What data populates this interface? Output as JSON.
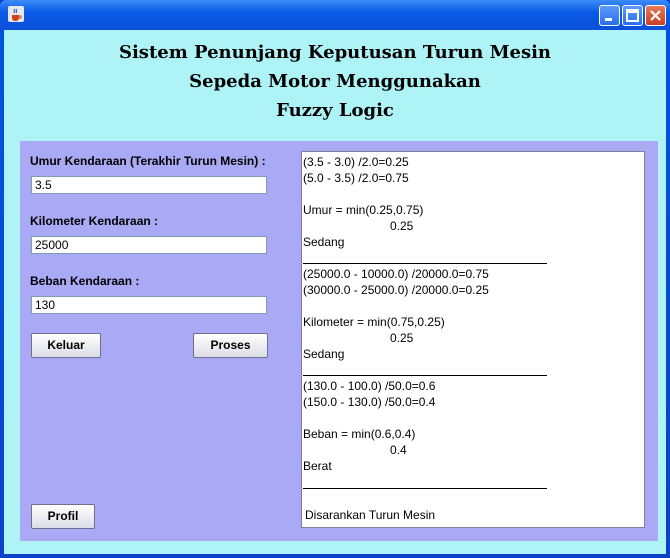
{
  "window": {
    "title_icon": "java-cup-icon",
    "controls": [
      "minimize-icon",
      "maximize-icon",
      "close-icon"
    ]
  },
  "heading": {
    "line1": "Sistem Penunjang Keputusan Turun Mesin",
    "line2": "Sepeda Motor Menggunakan",
    "line3": "Fuzzy Logic"
  },
  "form": {
    "umur_label": "Umur Kendaraan (Terakhir Turun Mesin) :",
    "umur_value": "3.5",
    "km_label": "Kilometer Kendaraan :",
    "km_value": "25000",
    "beban_label": "Beban Kendaraan :",
    "beban_value": "130",
    "keluar_label": "Keluar",
    "proses_label": "Proses",
    "profil_label": "Profil"
  },
  "output": {
    "umur": {
      "calc1": "(3.5 - 3.0) /2.0=0.25",
      "calc2": "(5.0 - 3.5) /2.0=0.75",
      "min": "Umur = min(0.25,0.75)",
      "result": "0.25",
      "category": "Sedang"
    },
    "km": {
      "calc1": "(25000.0 - 10000.0) /20000.0=0.75",
      "calc2": "(30000.0 - 25000.0) /20000.0=0.25",
      "min": "Kilometer = min(0.75,0.25)",
      "result": "0.25",
      "category": "Sedang"
    },
    "beban": {
      "calc1": "(130.0 - 100.0) /50.0=0.6",
      "calc2": "(150.0 - 130.0) /50.0=0.4",
      "min": "Beban = min(0.6,0.4)",
      "result": "0.4",
      "category": "Berat"
    },
    "conclusion": "Disarankan Turun Mesin"
  }
}
